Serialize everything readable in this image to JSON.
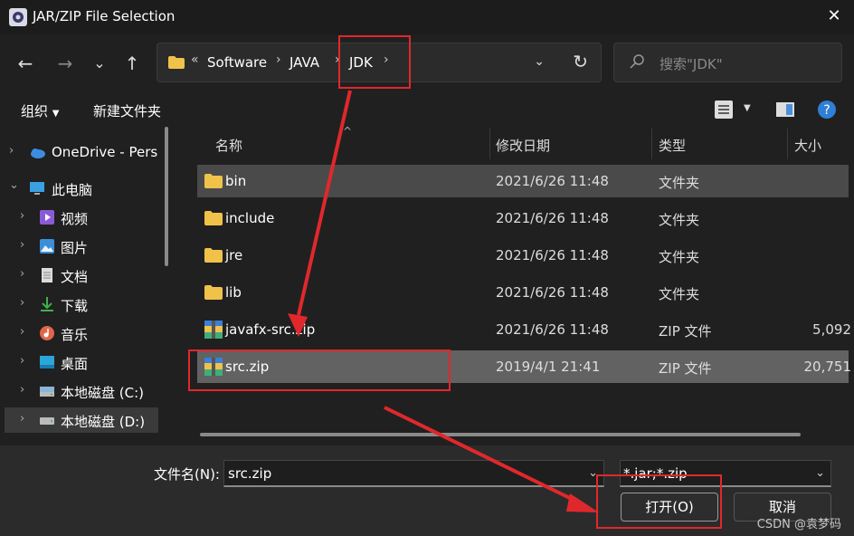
{
  "window": {
    "title": "JAR/ZIP File Selection"
  },
  "nav": {
    "back": "←",
    "forward": "→",
    "recent": "⌄",
    "up": "↑",
    "breadcrumb_more": "«",
    "breadcrumbs": [
      "Software",
      "JAVA",
      "JDK"
    ],
    "search_placeholder": "搜索\"JDK\""
  },
  "toolbar": {
    "organize": "组织",
    "new_folder": "新建文件夹"
  },
  "sidebar": {
    "items": [
      {
        "label": "OneDrive - Personal",
        "icon": "cloud-icon"
      },
      {
        "label": "此电脑",
        "icon": "computer-icon"
      },
      {
        "label": "视频",
        "icon": "video-icon"
      },
      {
        "label": "图片",
        "icon": "picture-icon"
      },
      {
        "label": "文档",
        "icon": "document-icon"
      },
      {
        "label": "下载",
        "icon": "download-icon"
      },
      {
        "label": "音乐",
        "icon": "music-icon"
      },
      {
        "label": "桌面",
        "icon": "desktop-icon"
      },
      {
        "label": "本地磁盘 (C:)",
        "icon": "drive-icon"
      },
      {
        "label": "本地磁盘 (D:)",
        "icon": "drive-icon"
      }
    ]
  },
  "columns": {
    "name": "名称",
    "date": "修改日期",
    "type": "类型",
    "size": "大小"
  },
  "files": [
    {
      "name": "bin",
      "date": "2021/6/26 11:48",
      "type": "文件夹",
      "size": "",
      "icon": "folder-icon"
    },
    {
      "name": "include",
      "date": "2021/6/26 11:48",
      "type": "文件夹",
      "size": "",
      "icon": "folder-icon"
    },
    {
      "name": "jre",
      "date": "2021/6/26 11:48",
      "type": "文件夹",
      "size": "",
      "icon": "folder-icon"
    },
    {
      "name": "lib",
      "date": "2021/6/26 11:48",
      "type": "文件夹",
      "size": "",
      "icon": "folder-icon"
    },
    {
      "name": "javafx-src.zip",
      "date": "2021/6/26 11:48",
      "type": "ZIP 文件",
      "size": "5,092",
      "icon": "zip-icon"
    },
    {
      "name": "src.zip",
      "date": "2019/4/1 21:41",
      "type": "ZIP 文件",
      "size": "20,751",
      "icon": "zip-icon"
    }
  ],
  "footer": {
    "filename_label": "文件名(N):",
    "filename_value": "src.zip",
    "filetype_value": "*.jar;*.zip",
    "open_label": "打开(O)",
    "cancel_label": "取消",
    "watermark": "CSDN @袁梦码"
  },
  "colors": {
    "annotation": "#e0282c",
    "background": "#202020",
    "selection": "#626262"
  }
}
